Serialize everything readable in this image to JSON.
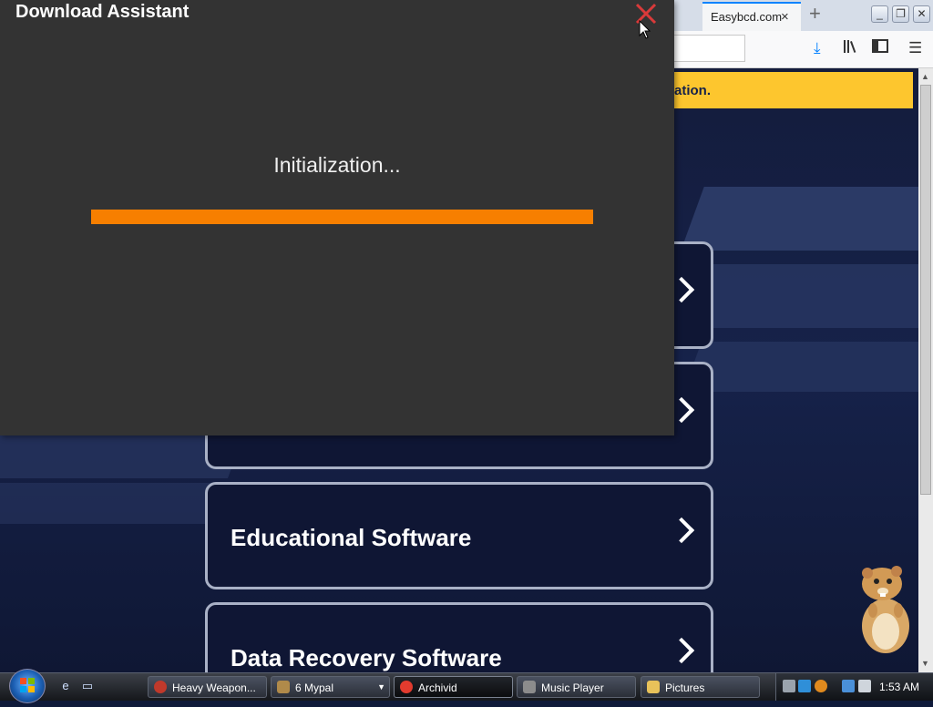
{
  "browser": {
    "tab_title": "Easybcd.com",
    "tab_close_icon": "×",
    "new_tab_icon": "+",
    "notice_text": "ation.",
    "cards": [
      {
        "label": ""
      },
      {
        "label": ""
      },
      {
        "label": "Educational Software"
      },
      {
        "label": "Data Recovery Software"
      }
    ]
  },
  "dialog": {
    "title": "Download Assistant",
    "status": "Initialization...",
    "progress_fraction": 1.0,
    "progress_color": "#f77f00",
    "close_color": "#d93a3a"
  },
  "taskbar": {
    "tasks": [
      {
        "label": "Heavy Weapon...",
        "icon_color": "#c0392b"
      },
      {
        "label": "6 Mypal",
        "icon_color": "#b08a4a"
      },
      {
        "label": "Archivid",
        "icon_color": "#e23b2e"
      },
      {
        "label": "Music Player",
        "icon_color": "#8c8c8c"
      },
      {
        "label": "Pictures",
        "icon_color": "#e8c25a"
      }
    ],
    "clock": "1:53 AM"
  }
}
